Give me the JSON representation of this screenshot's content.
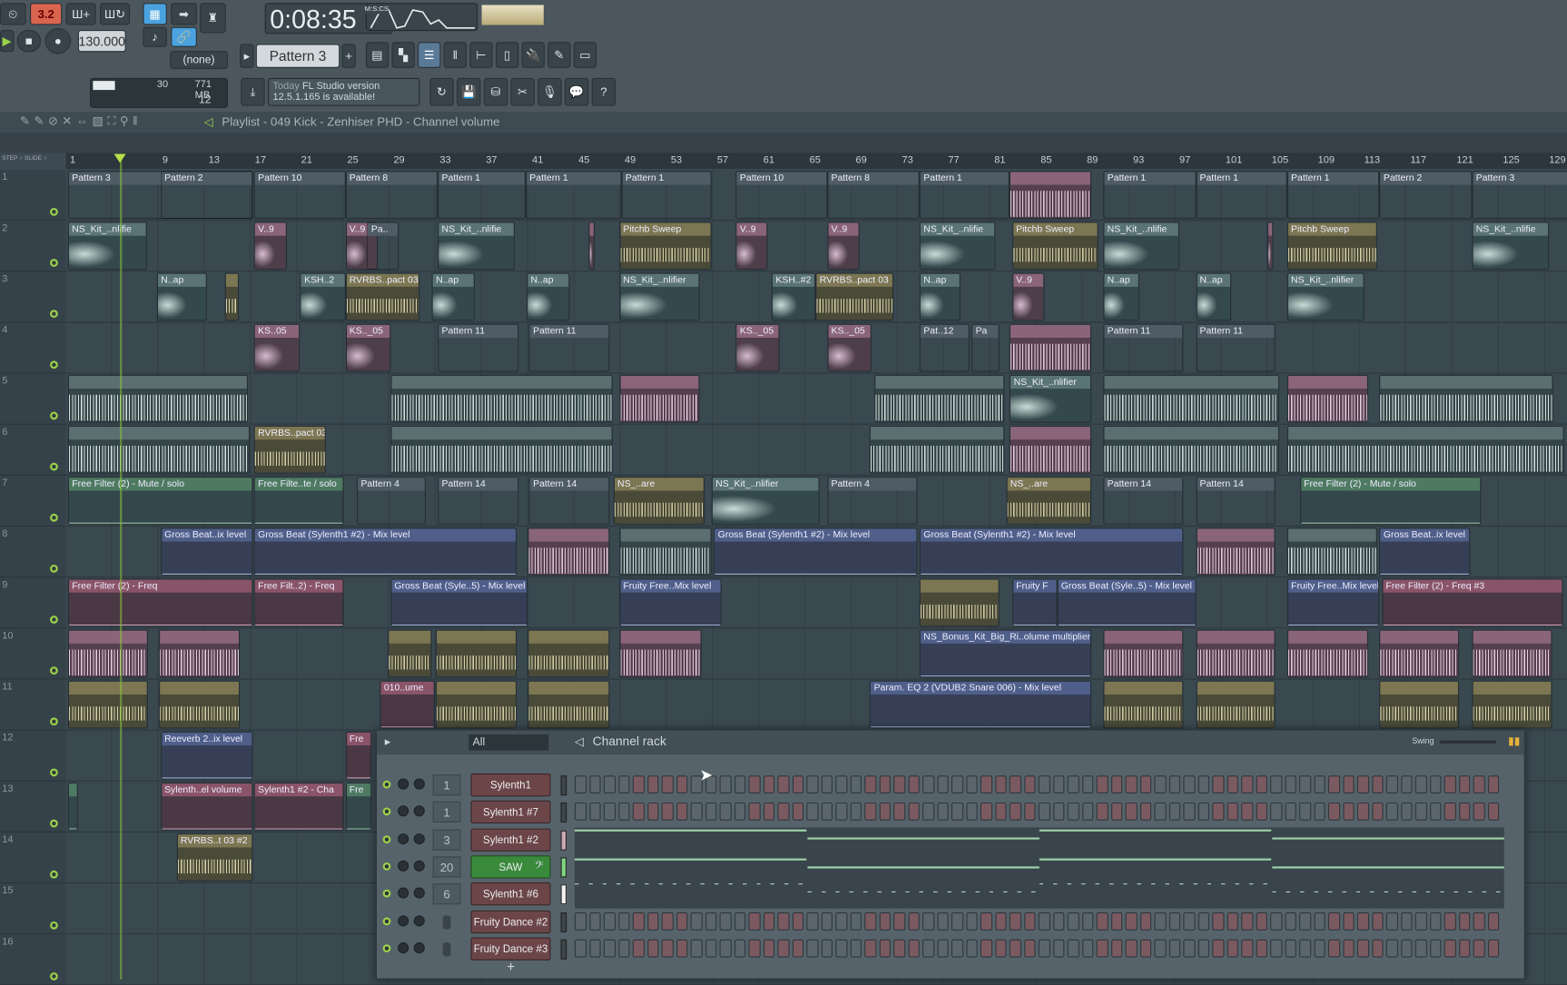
{
  "toolbar": {
    "pattern_mode_badge": "3.2",
    "tempo": "130.000",
    "time": "0:08:35",
    "time_format": "M:S:CS",
    "pattern": "Pattern 3",
    "snap": "(none)",
    "cpu": "30",
    "memory": "771 MB",
    "polyphony": "12",
    "news_today": "Today",
    "news_text_1": "FL Studio version",
    "news_text_2": "12.5.1.165 is available!"
  },
  "playlist": {
    "title": "Playlist - 049 Kick - Zenhiser PHD - Channel volume",
    "step_label": "STEP",
    "slide_label": "SLIDE",
    "ruler": [
      "1",
      "9",
      "13",
      "17",
      "21",
      "25",
      "29",
      "33",
      "37",
      "41",
      "45",
      "49",
      "53",
      "57",
      "61",
      "65",
      "69",
      "73",
      "77",
      "81",
      "85",
      "89",
      "93",
      "97",
      "101",
      "105",
      "109",
      "113",
      "117",
      "121",
      "125",
      "129"
    ],
    "tracks": [
      {
        "n": "1",
        "clips": [
          [
            "Pattern 3",
            1,
            17,
            "pattern"
          ],
          [
            "Pattern 2",
            9,
            17,
            "pattern"
          ],
          [
            "Pattern 10",
            17.1,
            25,
            "pattern"
          ],
          [
            "Pattern 8",
            25,
            33,
            "pattern"
          ],
          [
            "Pattern 1",
            33,
            40.6,
            "pattern"
          ],
          [
            "Pattern 1",
            40.6,
            48.9,
            "pattern"
          ],
          [
            "Pattern 1",
            48.9,
            56.7,
            "pattern"
          ],
          [
            "Pattern 10",
            58.8,
            66.7,
            "pattern"
          ],
          [
            "Pattern 8",
            66.7,
            74.7,
            "pattern"
          ],
          [
            "Pattern 1",
            74.7,
            82.5,
            "pattern"
          ],
          [
            "",
            82.5,
            89.6,
            "densep"
          ],
          [
            "Pattern 1",
            90.6,
            98.6,
            "pattern"
          ],
          [
            "Pattern 1",
            98.6,
            106.5,
            "pattern"
          ],
          [
            "Pattern 1",
            106.5,
            114.5,
            "pattern"
          ],
          [
            "Pattern 2",
            114.5,
            122.5,
            "pattern"
          ],
          [
            "Pattern 3",
            122.5,
            131,
            "pattern"
          ]
        ]
      },
      {
        "n": "2",
        "clips": [
          [
            "NS_Kit_..nlifie",
            1,
            7.8,
            "teal"
          ],
          [
            "V..9",
            17.1,
            19.9,
            "pink"
          ],
          [
            "V..9",
            25,
            27.8,
            "pink"
          ],
          [
            "Pa..",
            26.9,
            29.6,
            "pattern"
          ],
          [
            "NS_Kit_..nlifie",
            33,
            39.7,
            "teal"
          ],
          [
            "",
            46.1,
            46.6,
            "pink"
          ],
          [
            "Pitchb Sweep",
            48.7,
            56.7,
            "olive"
          ],
          [
            "V..9",
            58.8,
            61.5,
            "pink"
          ],
          [
            "V..9",
            66.7,
            69.5,
            "pink"
          ],
          [
            "NS_Kit_..nlifie",
            74.7,
            81.3,
            "teal"
          ],
          [
            "Pitchb Sweep",
            82.7,
            90.2,
            "olive"
          ],
          [
            "NS_Kit_..nlifie",
            90.6,
            97.2,
            "teal"
          ],
          [
            "",
            104.8,
            105.3,
            "pink"
          ],
          [
            "Pitchb Sweep",
            106.5,
            114.3,
            "olive"
          ],
          [
            "NS_Kit_..nlifie",
            122.5,
            129.2,
            "teal"
          ]
        ]
      },
      {
        "n": "3",
        "clips": [
          [
            "N..ap",
            8.7,
            13,
            "teal"
          ],
          [
            "",
            14.6,
            15.8,
            "olive"
          ],
          [
            "KSH..2",
            21.1,
            25,
            "teal"
          ],
          [
            "RVRBS..pact 03",
            25,
            31.4,
            "olive"
          ],
          [
            "N..ap",
            32.5,
            36.2,
            "teal"
          ],
          [
            "N..ap",
            40.7,
            44.4,
            "teal"
          ],
          [
            "NS_Kit_..nlifier",
            48.7,
            55.7,
            "teal"
          ],
          [
            "KSH..#2",
            61.9,
            65.7,
            "teal"
          ],
          [
            "RVRBS..pact 03",
            65.7,
            72.4,
            "olive"
          ],
          [
            "N..ap",
            74.7,
            78.2,
            "teal"
          ],
          [
            "V..9",
            82.7,
            85.5,
            "pink"
          ],
          [
            "N..ap",
            90.6,
            93.7,
            "teal"
          ],
          [
            "N..ap",
            98.6,
            101.7,
            "teal"
          ],
          [
            "NS_Kit_..nlifier",
            106.5,
            113.2,
            "teal"
          ]
        ]
      },
      {
        "n": "4",
        "clips": [
          [
            "KS..05",
            17.1,
            21.1,
            "pink"
          ],
          [
            "KS.._05",
            25,
            28.9,
            "pink"
          ],
          [
            "Pattern 11",
            33,
            40,
            "pattern"
          ],
          [
            "Pattern 11",
            40.9,
            47.9,
            "pattern"
          ],
          [
            "KS.._05",
            58.8,
            62.6,
            "pink"
          ],
          [
            "KS.._05",
            66.7,
            70.5,
            "pink"
          ],
          [
            "Pat..12",
            74.7,
            79,
            "pattern"
          ],
          [
            "Pa",
            79.2,
            81.6,
            "pattern"
          ],
          [
            "",
            82.5,
            89.6,
            "densep"
          ],
          [
            "Pattern 11",
            90.6,
            97.5,
            "pattern"
          ],
          [
            "Pattern 11",
            98.6,
            105.5,
            "pattern"
          ]
        ]
      },
      {
        "n": "5",
        "clips": [
          [
            "",
            1,
            16.6,
            "dense"
          ],
          [
            "",
            28.9,
            48.1,
            "dense"
          ],
          [
            "",
            48.7,
            55.7,
            "densep"
          ],
          [
            "",
            70.8,
            82,
            "dense"
          ],
          [
            "NS_Kit_..nlifier",
            82.5,
            89.6,
            "teal"
          ],
          [
            "",
            90.6,
            105.8,
            "dense"
          ],
          [
            "",
            106.5,
            113.5,
            "densep"
          ],
          [
            "",
            114.5,
            129.5,
            "dense"
          ]
        ]
      },
      {
        "n": "6",
        "clips": [
          [
            "",
            1,
            16.7,
            "dense"
          ],
          [
            "RVRBS..pact 03",
            17.1,
            23.3,
            "olive"
          ],
          [
            "",
            28.9,
            48.1,
            "dense"
          ],
          [
            "",
            70.4,
            82,
            "dense"
          ],
          [
            "",
            82.5,
            89.6,
            "densep"
          ],
          [
            "",
            90.6,
            105.8,
            "dense"
          ],
          [
            "",
            106.5,
            130.5,
            "dense"
          ]
        ]
      },
      {
        "n": "7",
        "clips": [
          [
            "Free Filter (2) - Mute / solo",
            1,
            17,
            "green"
          ],
          [
            "Free Filte..te / solo",
            17.1,
            24.9,
            "green"
          ],
          [
            "Pattern 4",
            26,
            32,
            "pattern"
          ],
          [
            "Pattern 14",
            33,
            40,
            "pattern"
          ],
          [
            "Pattern 14",
            40.9,
            47.9,
            "pattern"
          ],
          [
            "NS_..are",
            48.2,
            56.1,
            "olive"
          ],
          [
            "NS_Kit_..nlifier",
            56.7,
            66,
            "teal"
          ],
          [
            "Pattern 4",
            66.7,
            74.5,
            "pattern"
          ],
          [
            "NS_..are",
            82.2,
            89.6,
            "olive"
          ],
          [
            "Pattern 14",
            90.6,
            97.5,
            "pattern"
          ],
          [
            "Pattern 14",
            98.6,
            105.5,
            "pattern"
          ],
          [
            "Free Filter (2) - Mute / solo",
            107.6,
            123.3,
            "green"
          ]
        ]
      },
      {
        "n": "8",
        "clips": [
          [
            "Gross Beat..ix level",
            9,
            17,
            "blue"
          ],
          [
            "Gross Beat (Sylenth1 #2) - Mix level",
            17.1,
            39.8,
            "blue"
          ],
          [
            "",
            40.8,
            47.9,
            "densep"
          ],
          [
            "",
            48.7,
            56.7,
            "dense"
          ],
          [
            "Gross Beat (Sylenth1 #2) - Mix level",
            56.9,
            74.5,
            "blue"
          ],
          [
            "Gross Beat (Sylenth1 #2) - Mix level",
            74.7,
            97.5,
            "blue"
          ],
          [
            "",
            98.6,
            105.5,
            "densep"
          ],
          [
            "",
            106.5,
            114.3,
            "dense"
          ],
          [
            "Gross Beat..ix level",
            114.5,
            122.3,
            "blue"
          ]
        ]
      },
      {
        "n": "9",
        "clips": [
          [
            "Free Filter (2) - Freq",
            1,
            17,
            "autopink"
          ],
          [
            "Free Filt..2) - Freq",
            17.1,
            24.9,
            "autopink"
          ],
          [
            "Gross Beat (Syle..5) - Mix level",
            28.9,
            40.8,
            "blue"
          ],
          [
            "Fruity Free..Mix level",
            48.7,
            57.6,
            "blue"
          ],
          [
            "",
            74.7,
            81.6,
            "olive"
          ],
          [
            "Fruity F",
            82.7,
            86.6,
            "blue"
          ],
          [
            "Gross Beat (Syle..5) - Mix level",
            86.6,
            98.6,
            "blue"
          ],
          [
            "Fruity Free..Mix level",
            106.5,
            114.5,
            "blue"
          ],
          [
            "Free Filter (2) - Freq #3",
            114.7,
            130.4,
            "autopink"
          ]
        ]
      },
      {
        "n": "10",
        "clips": [
          [
            "",
            1,
            7.9,
            "densep"
          ],
          [
            "",
            8.9,
            15.9,
            "densep"
          ],
          [
            "",
            28.7,
            32.5,
            "olive"
          ],
          [
            "",
            32.8,
            39.8,
            "olive"
          ],
          [
            "",
            40.8,
            47.9,
            "olive"
          ],
          [
            "",
            48.7,
            55.8,
            "densep"
          ],
          [
            "NS_Bonus_Kit_Big_Ri..olume multiplier",
            74.7,
            89.6,
            "blue"
          ],
          [
            "",
            90.6,
            97.5,
            "densep"
          ],
          [
            "",
            98.6,
            105.5,
            "densep"
          ],
          [
            "",
            106.5,
            113.5,
            "densep"
          ],
          [
            "",
            114.5,
            121.4,
            "densep"
          ],
          [
            "",
            122.5,
            129.4,
            "densep"
          ]
        ]
      },
      {
        "n": "11",
        "clips": [
          [
            "",
            1,
            7.9,
            "olive"
          ],
          [
            "",
            8.9,
            15.9,
            "olive"
          ],
          [
            "010..ume",
            28,
            32.7,
            "autopink"
          ],
          [
            "",
            32.8,
            39.8,
            "olive"
          ],
          [
            "",
            40.8,
            47.9,
            "olive"
          ],
          [
            "Param. EQ 2 (VDUB2 Snare 006) - Mix level",
            70.4,
            89.6,
            "blue"
          ],
          [
            "",
            90.6,
            97.5,
            "olive"
          ],
          [
            "",
            98.6,
            105.5,
            "olive"
          ],
          [
            "",
            114.5,
            121.4,
            "olive"
          ],
          [
            "",
            122.5,
            129.4,
            "olive"
          ]
        ]
      },
      {
        "n": "12",
        "clips": [
          [
            "Reeverb 2..ix level",
            9,
            17,
            "blue"
          ],
          [
            "Fre",
            25,
            27.3,
            "autopink"
          ]
        ]
      },
      {
        "n": "13",
        "clips": [
          [
            "",
            1,
            1.9,
            "green"
          ],
          [
            "Sylenth..el volume",
            9,
            17,
            "autopink"
          ],
          [
            "Sylenth1 #2 - Cha",
            17.1,
            24.9,
            "autopink"
          ],
          [
            "Fre",
            25,
            27.3,
            "green"
          ]
        ]
      },
      {
        "n": "14",
        "clips": [
          [
            "RVRBS..t 03 #2",
            10.4,
            17,
            "olive"
          ]
        ]
      },
      {
        "n": "15",
        "clips": []
      },
      {
        "n": "16",
        "clips": []
      }
    ]
  },
  "channel_rack": {
    "title": "Channel rack",
    "filter": "All",
    "swing_label": "Swing",
    "add_label": "+",
    "channels": [
      {
        "name": "Sylenth1",
        "mixer": "1",
        "type": "steps"
      },
      {
        "name": "Sylenth1 #7",
        "mixer": "1",
        "type": "steps"
      },
      {
        "name": "Sylenth1 #2",
        "mixer": "3",
        "type": "roll"
      },
      {
        "name": "SAW",
        "mixer": "20",
        "type": "roll",
        "selected": true
      },
      {
        "name": "Sylenth1 #6",
        "mixer": "6",
        "type": "roll"
      },
      {
        "name": "Fruity Dance #2",
        "mixer": "",
        "type": "steps"
      },
      {
        "name": "Fruity Dance #3",
        "mixer": "",
        "type": "steps"
      }
    ]
  },
  "colors": {
    "accent": "#4aa3df",
    "selected_channel": "#3a8a3c",
    "playhead": "#9ad14a"
  }
}
